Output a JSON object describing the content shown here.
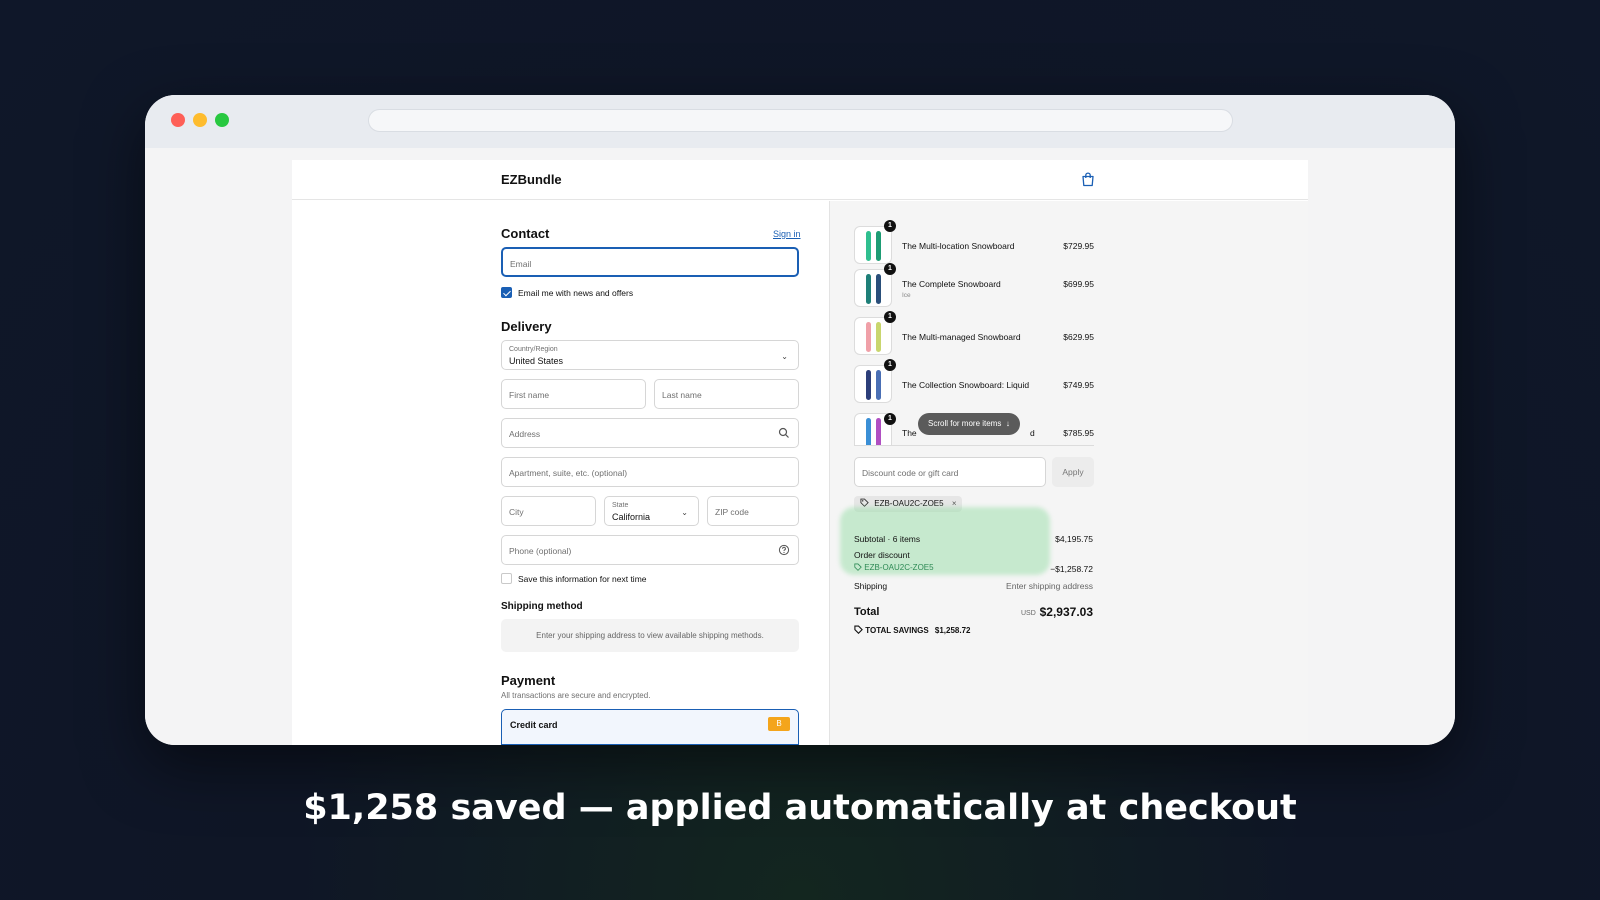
{
  "header": {
    "brand": "EZBundle",
    "cart_icon": "shopping-bag-icon"
  },
  "contact": {
    "title": "Contact",
    "sign_in": "Sign in",
    "email_placeholder": "Email",
    "newsletter_label": "Email me with news and offers",
    "newsletter_checked": true
  },
  "delivery": {
    "title": "Delivery",
    "country_label": "Country/Region",
    "country_value": "United States",
    "first_name": "First name",
    "last_name": "Last name",
    "address": "Address",
    "apartment": "Apartment, suite, etc. (optional)",
    "city": "City",
    "state_label": "State",
    "state_value": "California",
    "zip": "ZIP code",
    "phone": "Phone (optional)",
    "save_info": "Save this information for next time"
  },
  "shipping": {
    "title": "Shipping method",
    "message": "Enter your shipping address to view available shipping methods."
  },
  "payment": {
    "title": "Payment",
    "subtitle": "All transactions are secure and encrypted.",
    "method": "Credit card",
    "badge": "B"
  },
  "order": {
    "items": [
      {
        "qty": "1",
        "name": "The Multi-location Snowboard",
        "variant": "",
        "price": "$729.95"
      },
      {
        "qty": "1",
        "name": "The Complete Snowboard",
        "variant": "Ice",
        "price": "$699.95"
      },
      {
        "qty": "1",
        "name": "The Multi-managed Snowboard",
        "variant": "",
        "price": "$629.95"
      },
      {
        "qty": "1",
        "name": "The Collection Snowboard: Liquid",
        "variant": "",
        "price": "$749.95"
      },
      {
        "qty": "1",
        "name": "The",
        "name_end": "d",
        "variant": "",
        "price": "$785.95"
      }
    ],
    "scroll_hint": "Scroll for more items",
    "discount_placeholder": "Discount code or gift card",
    "apply": "Apply",
    "applied_code": "EZB-OAU2C-ZOE5",
    "subtotal_label": "Subtotal · 6 items",
    "subtotal_value": "$4,195.75",
    "order_discount_label": "Order discount",
    "order_discount_code": "EZB-OAU2C-ZOE5",
    "order_discount_value": "−$1,258.72",
    "shipping_label": "Shipping",
    "shipping_value": "Enter shipping address",
    "total_label": "Total",
    "total_currency": "USD",
    "total_value": "$2,937.03",
    "savings_label": "TOTAL SAVINGS",
    "savings_value": "$1,258.72"
  },
  "caption": "$1,258 saved — applied automatically at checkout"
}
